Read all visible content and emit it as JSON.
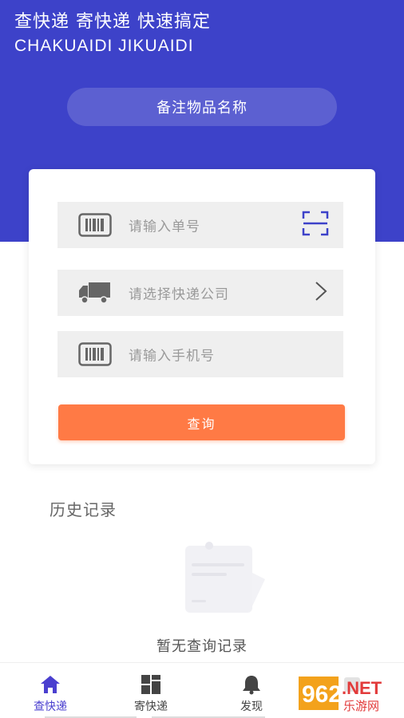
{
  "header": {
    "slogan": "查快递  寄快递  快速搞定",
    "slogan_en": "CHAKUAIDI  JIKUAIDI",
    "note_button": "备注物品名称"
  },
  "form": {
    "tracking_placeholder": "请输入单号",
    "company_placeholder": "请选择快递公司",
    "phone_placeholder": "请输入手机号",
    "query_button": "查询"
  },
  "history": {
    "title": "历史记录",
    "empty_text": "暂无查询记录"
  },
  "tabbar": {
    "items": [
      {
        "label": "查快递",
        "icon": "home-icon",
        "active": true
      },
      {
        "label": "寄快递",
        "icon": "grid-icon",
        "active": false
      },
      {
        "label": "发现",
        "icon": "bell-icon",
        "active": false
      },
      {
        "label": "",
        "icon": "profile-icon",
        "active": false
      }
    ]
  },
  "colors": {
    "primary": "#3d42c9",
    "accent_button": "#ff7a45",
    "active_tab": "#4a3fcf",
    "field_bg": "#efefef"
  },
  "watermark": {
    "brand": "962.NET",
    "subtitle": "乐游网"
  }
}
